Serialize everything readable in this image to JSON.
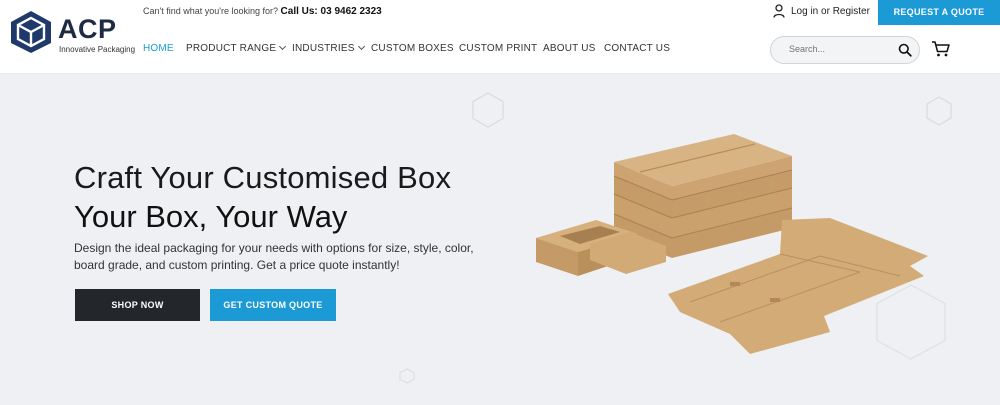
{
  "brand": {
    "name": "ACP",
    "tagline": "Innovative Packaging"
  },
  "topbar": {
    "help_text": "Can't find what you're looking for?",
    "call_label": "Call Us: 03 9462 2323",
    "login_label": "Log in or Register",
    "quote_button": "REQUEST A QUOTE"
  },
  "nav": {
    "items": [
      {
        "label": "HOME"
      },
      {
        "label": "PRODUCT RANGE"
      },
      {
        "label": "INDUSTRIES"
      },
      {
        "label": "CUSTOM BOXES"
      },
      {
        "label": "CUSTOM PRINT"
      },
      {
        "label": "ABOUT US"
      },
      {
        "label": "CONTACT US"
      }
    ]
  },
  "search": {
    "placeholder": "Search..."
  },
  "hero": {
    "title_line1": "Craft Your Customised Box",
    "title_line2": "Your Box, Your Way",
    "description": "Design the ideal packaging for your needs with options for size, style, color, board grade, and custom printing. Get a price quote instantly!",
    "shop_button": "SHOP NOW",
    "quote_button": "GET CUSTOM QUOTE"
  },
  "colors": {
    "accent": "#1b9ad6",
    "dark": "#23272b",
    "brand_navy": "#1f2a44",
    "hero_bg": "#eef0f3"
  },
  "icons": [
    "cube-logo-icon",
    "user-icon",
    "search-icon",
    "cart-icon",
    "chevron-down-icon"
  ]
}
